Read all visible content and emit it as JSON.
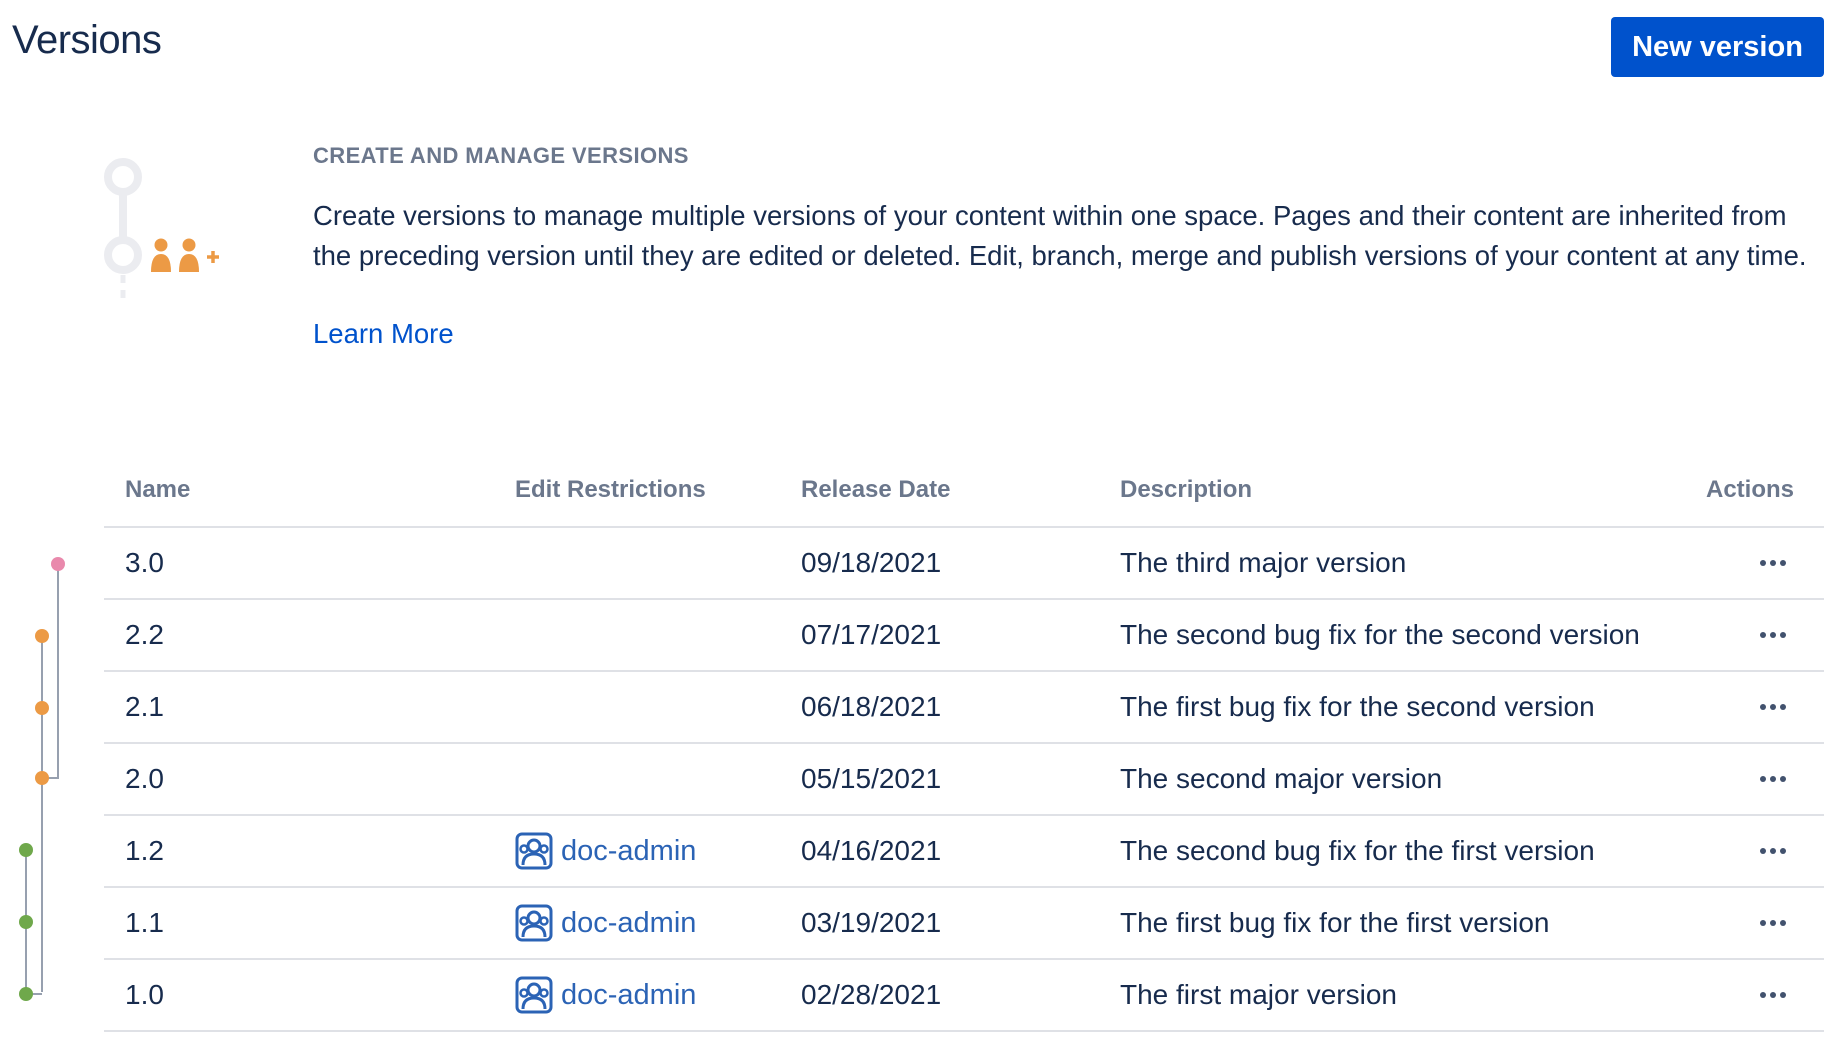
{
  "page": {
    "title": "Versions",
    "new_version_label": "New version"
  },
  "hero": {
    "heading": "CREATE AND MANAGE VERSIONS",
    "body": "Create versions to manage multiple versions of your content within one space. Pages and their content are inherited from the preceding version until they are edited or deleted. Edit, branch, merge and publish versions of your content at any time.",
    "learn_more": "Learn More"
  },
  "table": {
    "headers": {
      "name": "Name",
      "edit": "Edit Restrictions",
      "date": "Release Date",
      "desc": "Description",
      "actions": "Actions"
    },
    "rows": [
      {
        "name": "3.0",
        "edit": "",
        "date": "09/18/2021",
        "desc": "The third major version"
      },
      {
        "name": "2.2",
        "edit": "",
        "date": "07/17/2021",
        "desc": "The second bug fix for the second version"
      },
      {
        "name": "2.1",
        "edit": "",
        "date": "06/18/2021",
        "desc": "The first bug fix for the second version"
      },
      {
        "name": "2.0",
        "edit": "",
        "date": "05/15/2021",
        "desc": "The second major version"
      },
      {
        "name": "1.2",
        "edit": "doc-admin",
        "date": "04/16/2021",
        "desc": "The second bug fix for the first version"
      },
      {
        "name": "1.1",
        "edit": "doc-admin",
        "date": "03/19/2021",
        "desc": "The first bug fix for the first version"
      },
      {
        "name": "1.0",
        "edit": "doc-admin",
        "date": "02/28/2021",
        "desc": "The first major version"
      }
    ]
  },
  "icons": {
    "actions": "more-horizontal-icon",
    "restriction": "user-group-icon"
  },
  "colors": {
    "primary": "#0052cc",
    "link": "#2b63b5",
    "branch_pink": "#e989ac",
    "branch_orange": "#ec9a45",
    "branch_green": "#6fa84b",
    "line": "#97a0af"
  }
}
